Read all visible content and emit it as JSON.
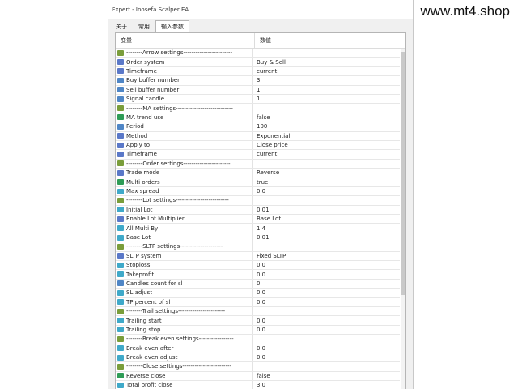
{
  "window": {
    "title": "Expert - Inosefa Scalper EA"
  },
  "brand": "www.mt4.shop",
  "tabs": [
    {
      "label": "关于"
    },
    {
      "label": "常用"
    },
    {
      "label": "输入参数"
    }
  ],
  "table": {
    "header": {
      "variable": "变量",
      "value": "数值"
    },
    "rows": [
      {
        "name": "--------Arrow settings------------------------",
        "value": "",
        "icon": "ab"
      },
      {
        "name": "Order system",
        "value": "Buy & Sell",
        "icon": "e"
      },
      {
        "name": "Timeframe",
        "value": "current",
        "icon": "e"
      },
      {
        "name": "Buy buffer number",
        "value": "3",
        "icon": "i"
      },
      {
        "name": "Sell buffer number",
        "value": "1",
        "icon": "i"
      },
      {
        "name": "Signal candle",
        "value": "1",
        "icon": "i"
      },
      {
        "name": "--------MA settings----------------------------",
        "value": "",
        "icon": "ab"
      },
      {
        "name": "MA trend use",
        "value": "false",
        "icon": "b"
      },
      {
        "name": "Period",
        "value": "100",
        "icon": "i"
      },
      {
        "name": "Method",
        "value": "Exponential",
        "icon": "e"
      },
      {
        "name": "Apply to",
        "value": "Close price",
        "icon": "e"
      },
      {
        "name": "Timeframe",
        "value": "current",
        "icon": "e"
      },
      {
        "name": "--------Order settings-----------------------",
        "value": "",
        "icon": "ab"
      },
      {
        "name": "Trade mode",
        "value": "Reverse",
        "icon": "e"
      },
      {
        "name": "Multi orders",
        "value": "true",
        "icon": "b"
      },
      {
        "name": "Max spread",
        "value": "0.0",
        "icon": "d"
      },
      {
        "name": "--------Lot settings--------------------------",
        "value": "",
        "icon": "ab"
      },
      {
        "name": "Initial Lot",
        "value": "0.01",
        "icon": "d"
      },
      {
        "name": "Enable Lot Multiplier",
        "value": "Base Lot",
        "icon": "e"
      },
      {
        "name": "All Multi By",
        "value": "1.4",
        "icon": "d"
      },
      {
        "name": "Base Lot",
        "value": "0.01",
        "icon": "d"
      },
      {
        "name": "--------SLTP settings---------------------",
        "value": "",
        "icon": "ab"
      },
      {
        "name": "SLTP system",
        "value": "Fixed SLTP",
        "icon": "e"
      },
      {
        "name": "Stoploss",
        "value": "0.0",
        "icon": "d"
      },
      {
        "name": "Takeprofit",
        "value": "0.0",
        "icon": "d"
      },
      {
        "name": "Candles count for sl",
        "value": "0",
        "icon": "i"
      },
      {
        "name": "SL adjust",
        "value": "0.0",
        "icon": "d"
      },
      {
        "name": "TP percent of sl",
        "value": "0.0",
        "icon": "d"
      },
      {
        "name": "--------Trail settings-----------------------",
        "value": "",
        "icon": "ab"
      },
      {
        "name": "Trailing start",
        "value": "0.0",
        "icon": "d"
      },
      {
        "name": "Trailing stop",
        "value": "0.0",
        "icon": "d"
      },
      {
        "name": "--------Break even settings-----------------",
        "value": "",
        "icon": "ab"
      },
      {
        "name": "Break even after",
        "value": "0.0",
        "icon": "d"
      },
      {
        "name": "Break even adjust",
        "value": "0.0",
        "icon": "d"
      },
      {
        "name": "--------Close settings------------------------",
        "value": "",
        "icon": "ab"
      },
      {
        "name": "Reverse close",
        "value": "false",
        "icon": "b"
      },
      {
        "name": "Total profit close",
        "value": "3.0",
        "icon": "d"
      }
    ]
  }
}
